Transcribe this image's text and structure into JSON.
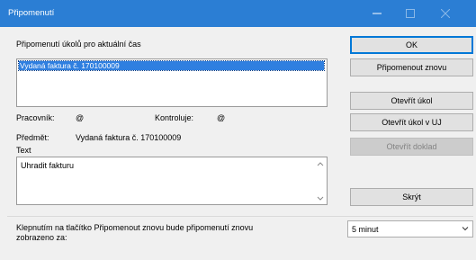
{
  "window": {
    "title": "Připomenutí",
    "minimize_icon": "minimize-icon",
    "maximize_icon": "maximize-icon",
    "close_icon": "close-icon",
    "titlebar_color": "#2b7ed4"
  },
  "header_label": "Připomenutí úkolů pro aktuální čas",
  "reminder_list": {
    "items": [
      "Vydaná faktura č. 170100009"
    ],
    "selected_index": 0,
    "selection_color": "#2f7fe0"
  },
  "details": {
    "worker_label": "Pracovník:",
    "worker_value": "@",
    "checker_label": "Kontroluje:",
    "checker_value": "@",
    "subject_label": "Předmět:",
    "subject_value": "Vydaná faktura č. 170100009",
    "text_label": "Text",
    "text_value": "Uhradit fakturu"
  },
  "buttons": {
    "ok": "OK",
    "remind_again": "Připomenout znovu",
    "open_task": "Otevřít úkol",
    "open_task_uj": "Otevřít úkol v UJ",
    "open_document": "Otevřít doklad",
    "hide": "Skrýt"
  },
  "footer": {
    "note_line1": "Klepnutím na tlačítko Připomenout znovu bude připomenutí znovu",
    "note_line2": "zobrazeno za:",
    "interval_select": {
      "value": "5 minut"
    }
  }
}
